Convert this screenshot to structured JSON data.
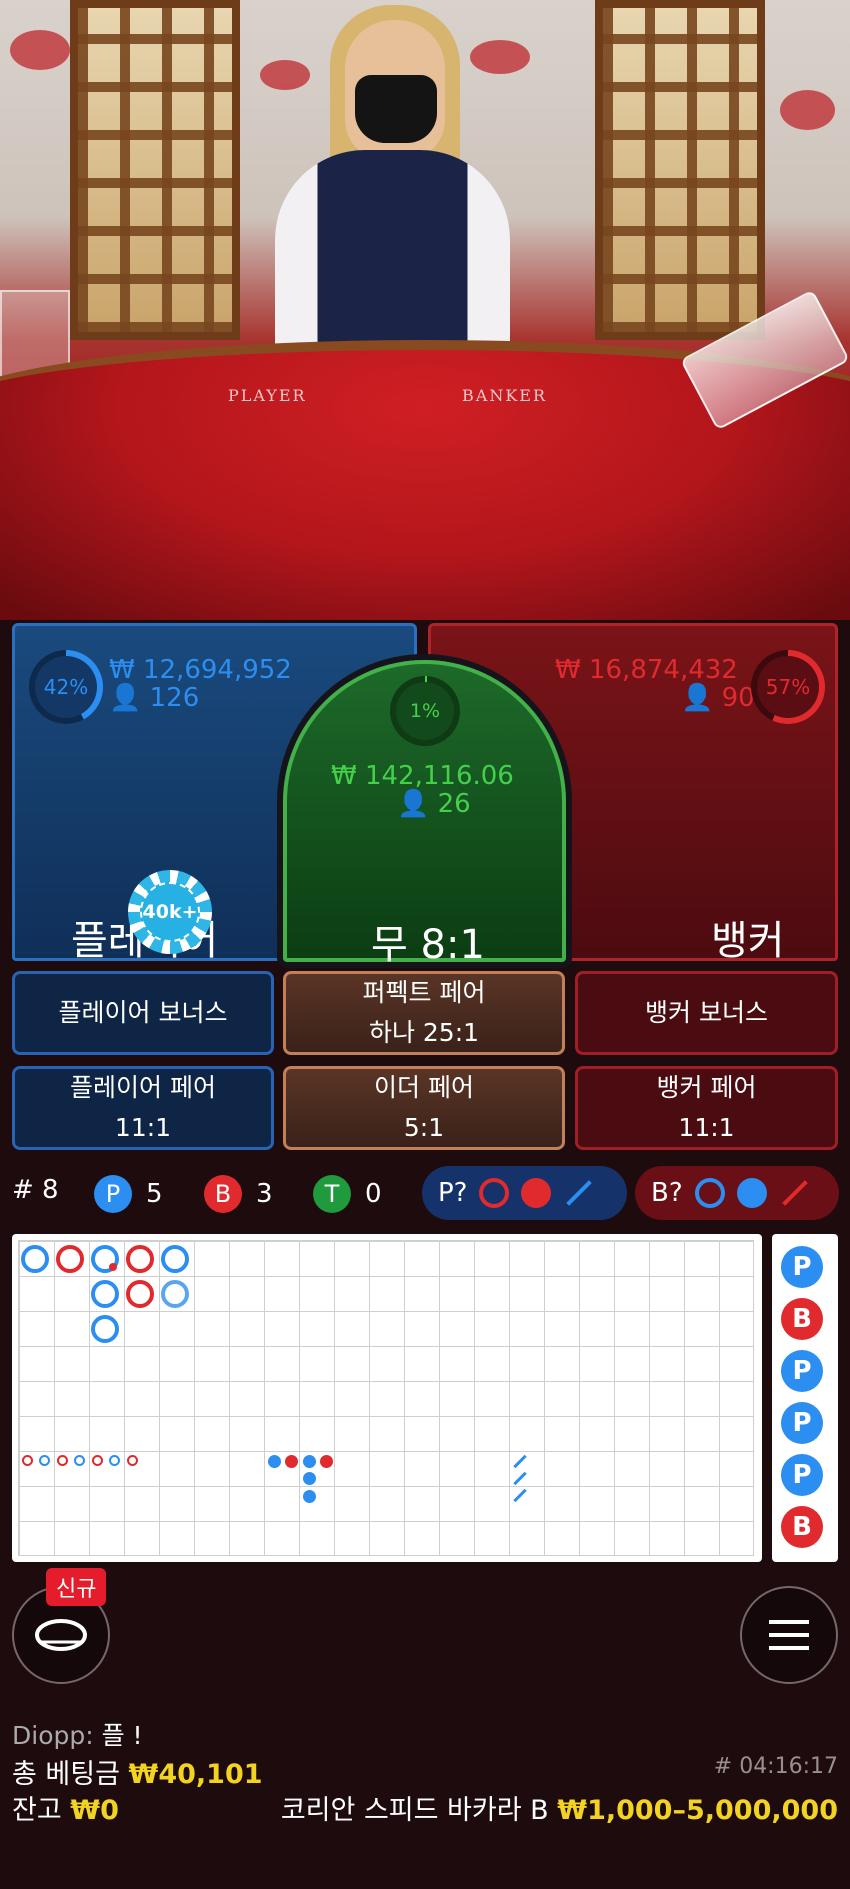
{
  "video": {
    "table_label_player": "PLAYER",
    "table_label_banker": "BANKER"
  },
  "player": {
    "percent": "42%",
    "amount": "₩ 12,694,952",
    "users": "126",
    "label": "플레이어",
    "color": "#2b8ef0"
  },
  "tie": {
    "percent": "1%",
    "amount": "₩ 142,116.06",
    "users": "26",
    "label": "무 8:1",
    "color": "#44d04a"
  },
  "banker": {
    "percent": "57%",
    "amount": "₩ 16,874,432",
    "users": "90",
    "label": "뱅커",
    "color": "#e12a2e"
  },
  "chip": {
    "label": "40k+"
  },
  "side_bets": {
    "player_bonus": "플레이어 보너스",
    "perfect_pair_line1": "퍼펙트 페어",
    "perfect_pair_line2": "하나 25:1",
    "banker_bonus": "뱅커 보너스",
    "player_pair_line1": "플레이어 페어",
    "player_pair_line2": "11:1",
    "either_pair_line1": "이더 페어",
    "either_pair_line2": "5:1",
    "banker_pair_line1": "뱅커 페어",
    "banker_pair_line2": "11:1"
  },
  "stats": {
    "rounds_label": "# 8",
    "p_letter": "P",
    "p_count": "5",
    "b_letter": "B",
    "b_count": "3",
    "t_letter": "T",
    "t_count": "0",
    "player_predict": "P?",
    "banker_predict": "B?"
  },
  "side_road": [
    "P",
    "B",
    "P",
    "P",
    "P",
    "B"
  ],
  "badge": "신규",
  "chat": {
    "user": "Diopp:",
    "message": "플 !"
  },
  "footer": {
    "total_bet_label": "총 베팅금",
    "total_bet_value": "₩40,101",
    "balance_label": "잔고",
    "balance_value": "₩0",
    "round_id": "# 04:16:17",
    "table_name": "코리안 스피드 바카라 B",
    "limits": "₩1,000–5,000,000"
  }
}
